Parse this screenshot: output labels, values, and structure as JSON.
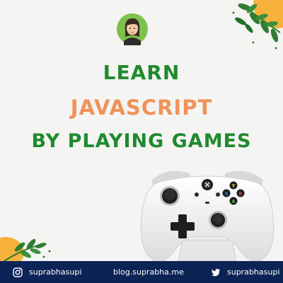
{
  "colors": {
    "background": "#f4f4f2",
    "heading_green": "#1f8a2e",
    "heading_orange": "#f0925a",
    "footer_bg": "#0c2455",
    "footer_text": "#ffffff",
    "leaf_green": "#2e7d32",
    "accent_orange": "#f6b23a"
  },
  "avatar": {
    "icon": "profile-avatar"
  },
  "headline": {
    "line1": "LEARN",
    "line2": "JAVASCRIPT",
    "line3": "BY PLAYING GAMES"
  },
  "illustration": {
    "icon": "game-controller"
  },
  "footer": {
    "instagram": {
      "icon": "instagram-icon",
      "handle": "suprabhasupi"
    },
    "blog": {
      "url": "blog.suprabha.me"
    },
    "twitter": {
      "icon": "twitter-icon",
      "handle": "suprabhasupi"
    }
  }
}
